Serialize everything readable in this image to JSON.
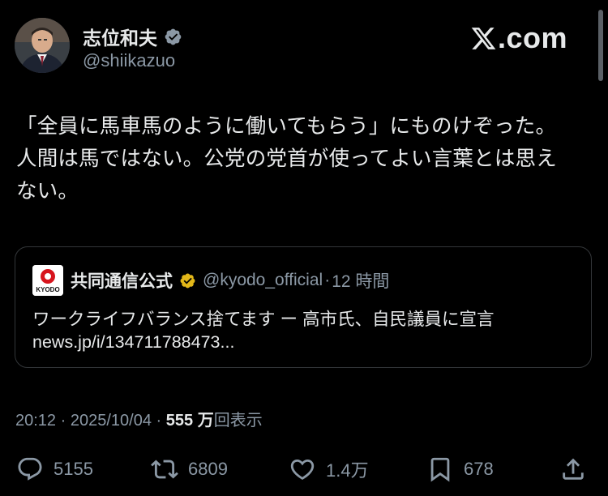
{
  "author": {
    "display_name": "志位和夫",
    "handle": "@shiikazuo",
    "verified_color": "#8b98a5"
  },
  "brand": {
    "logo_text": ".com",
    "icon": "x-logo-icon"
  },
  "tweet": {
    "text": "「全員に馬車馬のように働いてもらう」にものけぞった。人間は馬ではない。公党の党首が使ってよい言葉とは思えない。"
  },
  "quote": {
    "logo_text": "KYODO",
    "name": "共同通信公式",
    "handle": "@kyodo_official",
    "separator": "·",
    "time": "12 時間",
    "headline": "ワークライフバランス捨てます ー 高市氏、自民議員に宣言",
    "link": "news.jp/i/134711788473...",
    "verified_color": "#e2b719"
  },
  "meta": {
    "time": "20:12",
    "separator1": "·",
    "date": "2025/10/04",
    "separator2": "·",
    "views_count": "555 万",
    "views_label": "回表示"
  },
  "actions": {
    "reply_count": "5155",
    "retweet_count": "6809",
    "like_count": "1.4万",
    "bookmark_count": "678"
  },
  "colors": {
    "background": "#000000",
    "text": "#e7e9ea",
    "secondary": "#8b98a5",
    "border": "#333639"
  }
}
